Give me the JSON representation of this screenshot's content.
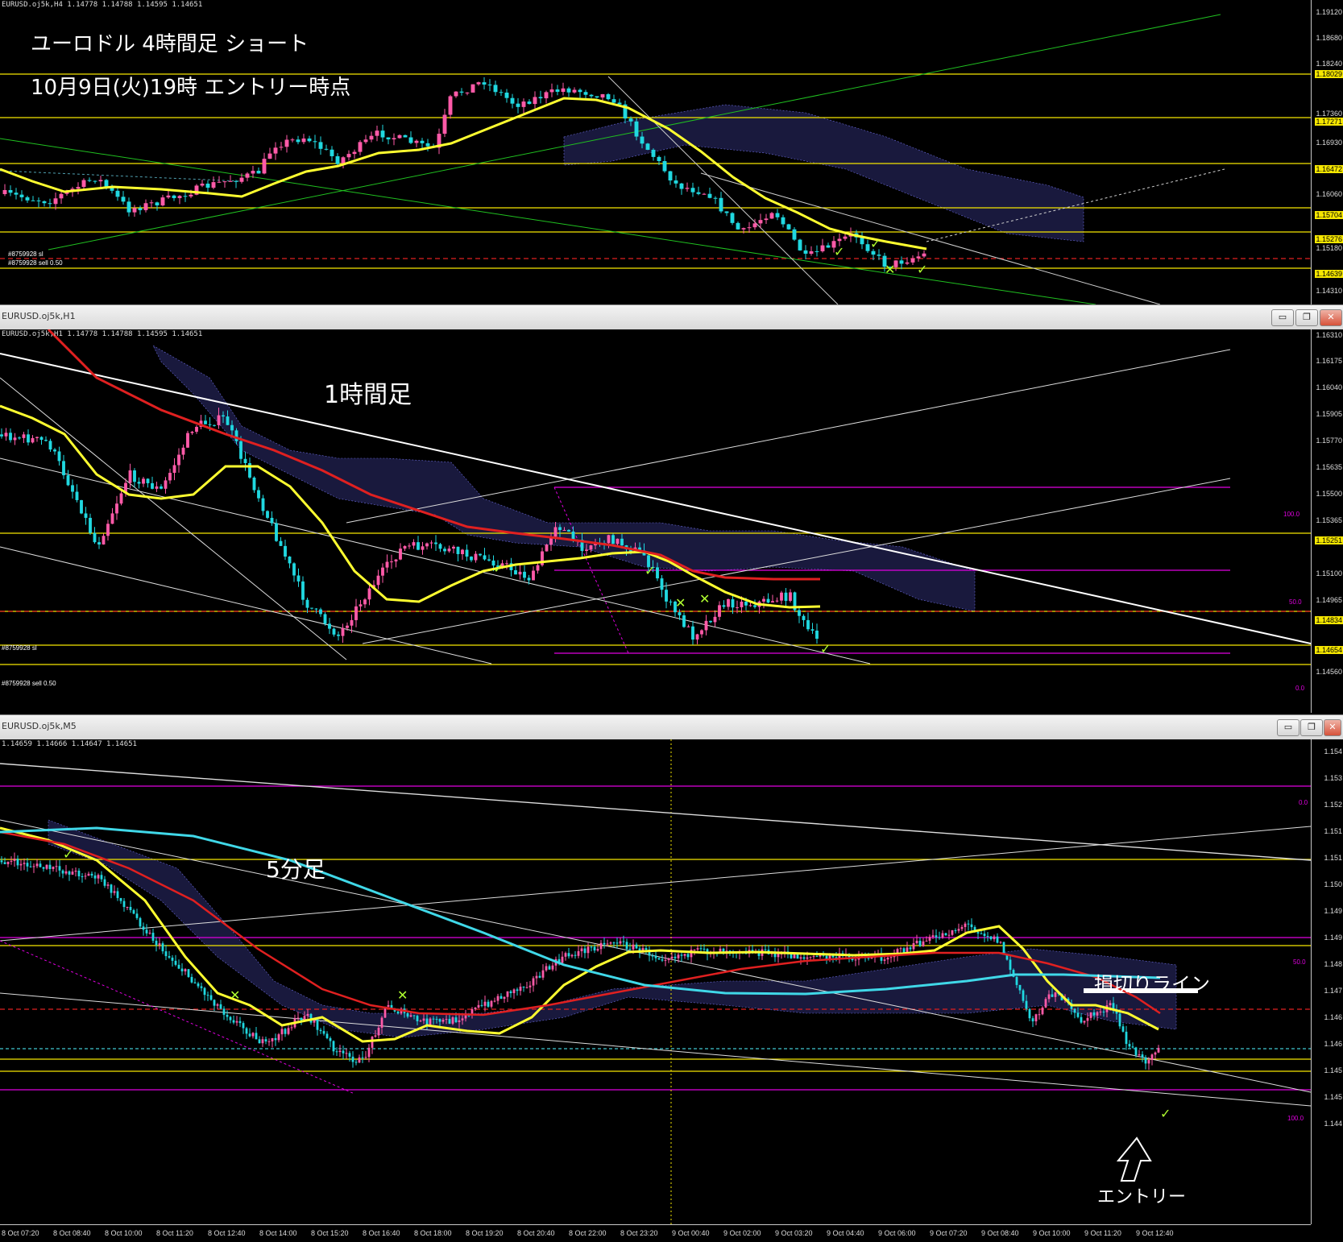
{
  "pane1": {
    "info": "EURUSD.oj5k,H4  1.14778 1.14788 1.14595 1.14651",
    "caption_line1": "ユーロドル 4時間足 ショート",
    "caption_line2": "10月9日(火)19時 エントリー時点",
    "price_ticks": [
      "1.19120",
      "1.18680",
      "1.18240",
      "1.17800",
      "1.17360",
      "1.16930",
      "1.16490",
      "1.16060",
      "1.15620",
      "1.15180",
      "1.14740",
      "1.14310"
    ],
    "price_tags": [
      "1.18029",
      "1.17271",
      "1.16472",
      "1.15704",
      "1.15276",
      "1.14639"
    ],
    "order_sl": "#8759928 sl",
    "order_sell": "#8759928 sell 0.50"
  },
  "pane2": {
    "title": "EURUSD.oj5k,H1",
    "info": "EURUSD.oj5k,H1  1.14778 1.14788 1.14595 1.14651",
    "caption": "1時間足",
    "price_ticks": [
      "1.16310",
      "1.16175",
      "1.16040",
      "1.15905",
      "1.15770",
      "1.15635",
      "1.15500",
      "1.15365",
      "1.15230",
      "1.15100",
      "1.14965",
      "1.14830",
      "1.14695",
      "1.14560"
    ],
    "price_tags": [
      "1.15251",
      "1.14834",
      "1.14654"
    ],
    "fib_labels": [
      "100.0",
      "50.0",
      "0.0"
    ],
    "order_sl": "#8759928 sl",
    "order_sell": "#8759928 sell 0.50"
  },
  "pane3": {
    "title": "EURUSD.oj5k,M5",
    "info": "1.14659 1.14666 1.14647 1.14651",
    "caption": "5分足",
    "stoploss_label": "損切りライン",
    "entry_label": "エントリー",
    "price_ticks": [
      "1.154",
      "1.153",
      "1.152",
      "1.151",
      "1.151",
      "1.150",
      "1.149",
      "1.149",
      "1.148",
      "1.147",
      "1.146",
      "1.146",
      "1.145",
      "1.145",
      "1.144"
    ],
    "fib_labels": [
      "0.0",
      "50.0",
      "100.0"
    ],
    "time_labels": [
      "8 Oct 07:20",
      "8 Oct 08:40",
      "8 Oct 10:00",
      "8 Oct 11:20",
      "8 Oct 12:40",
      "8 Oct 14:00",
      "8 Oct 15:20",
      "8 Oct 16:40",
      "8 Oct 18:00",
      "8 Oct 19:20",
      "8 Oct 20:40",
      "8 Oct 22:00",
      "8 Oct 23:20",
      "9 Oct 00:40",
      "9 Oct 02:00",
      "9 Oct 03:20",
      "9 Oct 04:40",
      "9 Oct 06:00",
      "9 Oct 07:20",
      "9 Oct 08:40",
      "9 Oct 10:00",
      "9 Oct 11:20",
      "9 Oct 12:40"
    ]
  },
  "window_buttons": {
    "minimize": "▭",
    "restore": "❐",
    "close": "✕"
  },
  "colors": {
    "level": "#f5e600",
    "fib": "#e000e0",
    "ma_fast": "#ffff30",
    "ma_mid": "#e02020",
    "ma_slow": "#40d8e8",
    "bull": "#ff5aa8",
    "bear": "#20d8e0",
    "kumo": "#6a6adc"
  }
}
